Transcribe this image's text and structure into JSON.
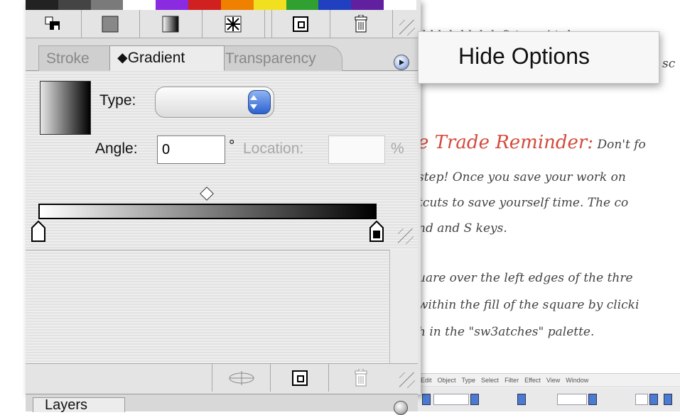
{
  "colors": {
    "tab_text_inactive": "#888888",
    "accent_red": "#d44a3c",
    "aqua_blue": "#2c62d1"
  },
  "top_toolbar": {
    "icons": [
      "align-icon",
      "fill-swatch-icon",
      "gradient-swatch-icon",
      "pattern-icon",
      "new-item-icon",
      "trash-icon"
    ]
  },
  "tabs": [
    {
      "label": "Stroke"
    },
    {
      "label": "⬥Gradient"
    },
    {
      "label": "Transparency"
    }
  ],
  "gradient": {
    "type_label": "Type:",
    "angle_label": "Angle:",
    "angle_value": "0",
    "degree_symbol": "°",
    "location_label": "Location:",
    "location_value": "",
    "percent_symbol": "%"
  },
  "popup": {
    "hide_options": "Hide Options"
  },
  "document": {
    "line1": "d blah blah left to … i t d r",
    "line1b": "sc",
    "heading": "e Trade Reminder:",
    "heading_tail": " Don't fo",
    "line2": " step! Once you save your work on",
    "line3": "tcuts to save yourself time. The co",
    "line4": "nd and S keys.",
    "line5": "uare over the left edges of the thre",
    "line6": "within the fill of the square by clicki",
    "line7": "h in the \"sw3atches\" palette."
  },
  "mini_menubar": [
    "Edit",
    "Object",
    "Type",
    "Select",
    "Filter",
    "Effect",
    "View",
    "Window"
  ],
  "layers": {
    "tab_label": "Layers"
  }
}
